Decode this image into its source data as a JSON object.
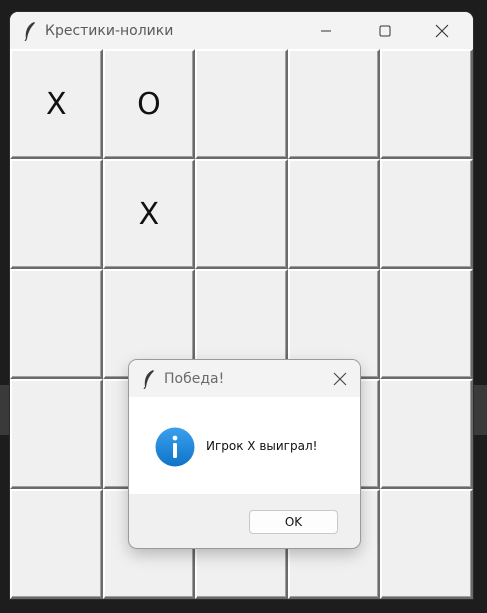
{
  "window": {
    "title": "Крестики-нолики"
  },
  "board": {
    "cells": [
      [
        "X",
        "O",
        "",
        "",
        ""
      ],
      [
        "",
        "X",
        "",
        "",
        ""
      ],
      [
        "",
        "",
        "",
        "",
        ""
      ],
      [
        "",
        "",
        "",
        "",
        ""
      ],
      [
        "",
        "",
        "",
        "",
        ""
      ]
    ]
  },
  "dialog": {
    "title": "Победа!",
    "message": "Игрок X выиграл!",
    "ok_label": "OK",
    "icon": "info-icon"
  },
  "colors": {
    "info_icon": "#1a88d8",
    "window_bg": "#f0f0f0"
  }
}
